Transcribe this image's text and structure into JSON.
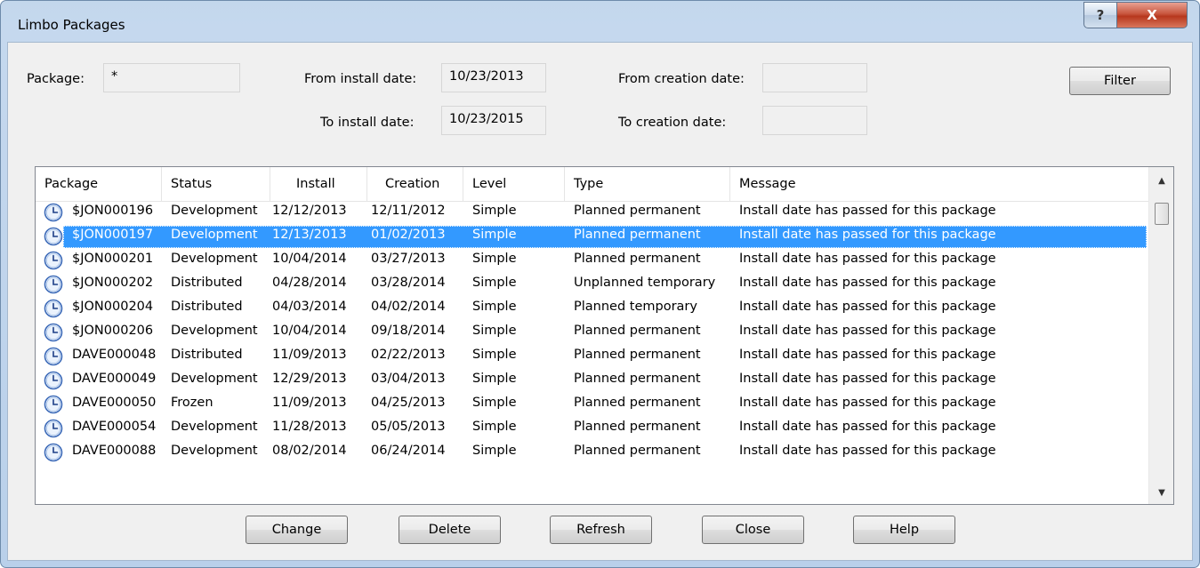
{
  "window": {
    "title": "Limbo Packages",
    "help_glyph": "?",
    "close_glyph": "X"
  },
  "filters": {
    "package_label": "Package:",
    "package_value": "*",
    "from_install_label": "From install date:",
    "from_install_value": "10/23/2013",
    "to_install_label": "To install date:",
    "to_install_value": "10/23/2015",
    "from_creation_label": "From creation date:",
    "from_creation_value": "",
    "to_creation_label": "To creation date:",
    "to_creation_value": "",
    "filter_button": "Filter"
  },
  "table": {
    "columns": [
      "Package",
      "Status",
      "Install",
      "Creation",
      "Level",
      "Type",
      "Message"
    ],
    "selected_index": 1,
    "rows": [
      {
        "package": "$JON000196",
        "status": "Development",
        "install": "12/12/2013",
        "creation": "12/11/2012",
        "level": "Simple",
        "type": "Planned permanent",
        "message": "Install date has passed for this package"
      },
      {
        "package": "$JON000197",
        "status": "Development",
        "install": "12/13/2013",
        "creation": "01/02/2013",
        "level": "Simple",
        "type": "Planned permanent",
        "message": "Install date has passed for this package"
      },
      {
        "package": "$JON000201",
        "status": "Development",
        "install": "10/04/2014",
        "creation": "03/27/2013",
        "level": "Simple",
        "type": "Planned permanent",
        "message": "Install date has passed for this package"
      },
      {
        "package": "$JON000202",
        "status": "Distributed",
        "install": "04/28/2014",
        "creation": "03/28/2014",
        "level": "Simple",
        "type": "Unplanned temporary",
        "message": "Install date has passed for this package"
      },
      {
        "package": "$JON000204",
        "status": "Distributed",
        "install": "04/03/2014",
        "creation": "04/02/2014",
        "level": "Simple",
        "type": "Planned temporary",
        "message": "Install date has passed for this package"
      },
      {
        "package": "$JON000206",
        "status": "Development",
        "install": "10/04/2014",
        "creation": "09/18/2014",
        "level": "Simple",
        "type": "Planned permanent",
        "message": "Install date has passed for this package"
      },
      {
        "package": "DAVE000048",
        "status": "Distributed",
        "install": "11/09/2013",
        "creation": "02/22/2013",
        "level": "Simple",
        "type": "Planned permanent",
        "message": "Install date has passed for this package"
      },
      {
        "package": "DAVE000049",
        "status": "Development",
        "install": "12/29/2013",
        "creation": "03/04/2013",
        "level": "Simple",
        "type": "Planned permanent",
        "message": "Install date has passed for this package"
      },
      {
        "package": "DAVE000050",
        "status": "Frozen",
        "install": "11/09/2013",
        "creation": "04/25/2013",
        "level": "Simple",
        "type": "Planned permanent",
        "message": "Install date has passed for this package"
      },
      {
        "package": "DAVE000054",
        "status": "Development",
        "install": "11/28/2013",
        "creation": "05/05/2013",
        "level": "Simple",
        "type": "Planned permanent",
        "message": "Install date has passed for this package"
      },
      {
        "package": "DAVE000088",
        "status": "Development",
        "install": "08/02/2014",
        "creation": "06/24/2014",
        "level": "Simple",
        "type": "Planned permanent",
        "message": "Install date has passed for this package"
      }
    ],
    "row_icon": "clock-icon"
  },
  "buttons": {
    "change": "Change",
    "delete": "Delete",
    "refresh": "Refresh",
    "close": "Close",
    "help": "Help"
  },
  "colors": {
    "selection": "#3399ff",
    "title_gradient": "#c3d7ec",
    "close_button": "#c8553d"
  }
}
